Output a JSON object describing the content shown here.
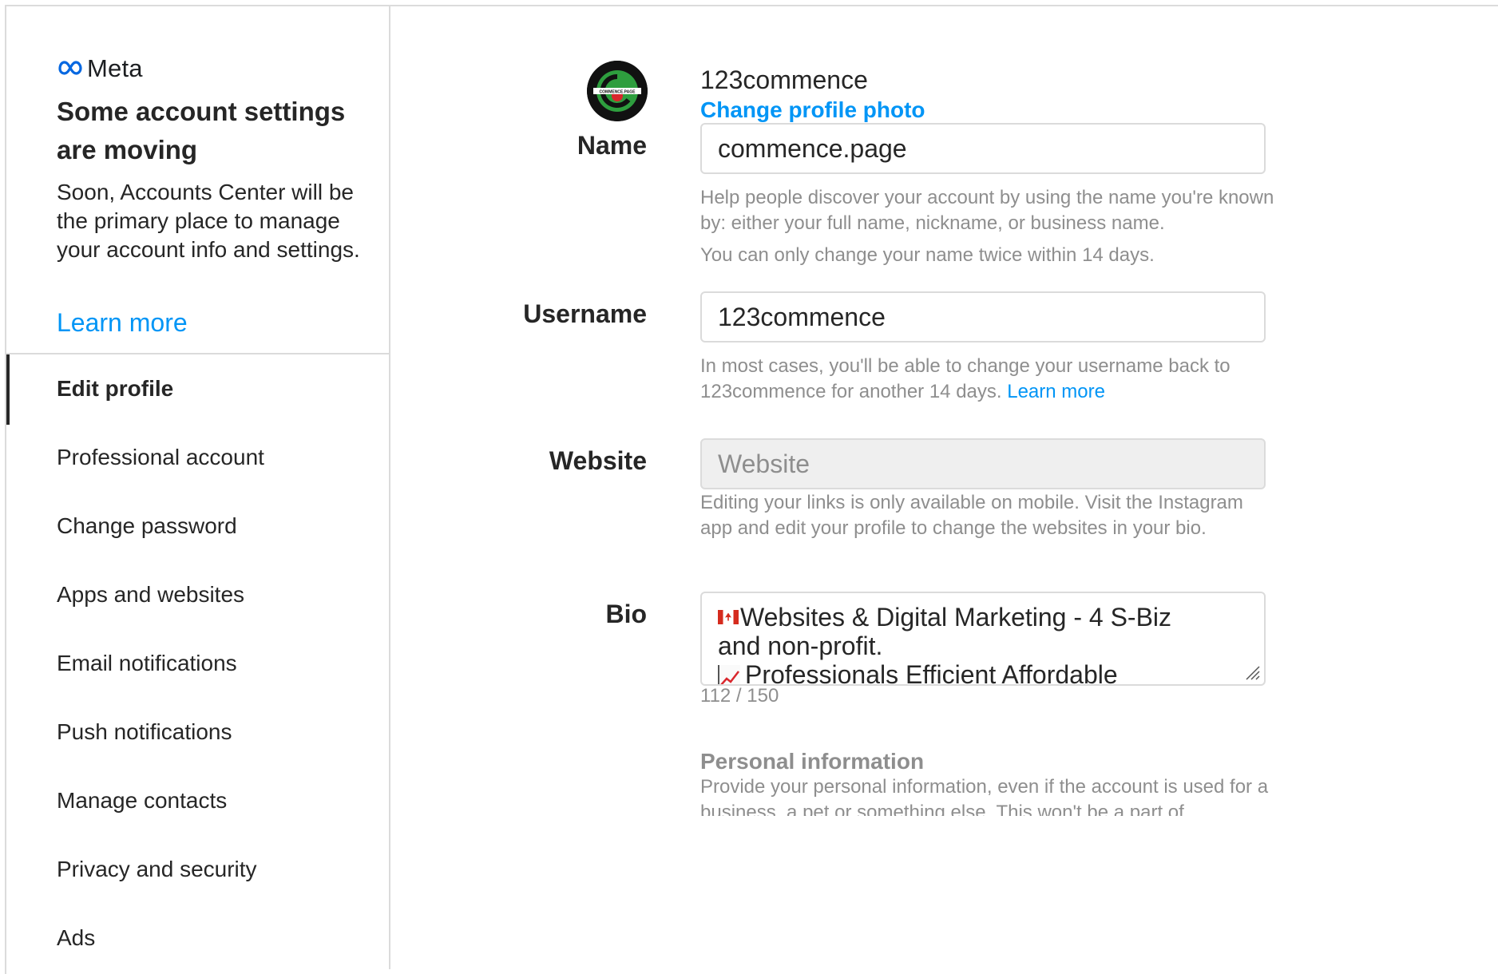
{
  "brand": {
    "name": "Meta",
    "color": "#0668E1"
  },
  "notice": {
    "title": "Some account settings are moving",
    "body": "Soon, Accounts Center will be the primary place to manage your account info and settings.",
    "learn_more": "Learn more"
  },
  "nav": {
    "items": [
      {
        "label": "Edit profile",
        "active": true
      },
      {
        "label": "Professional account"
      },
      {
        "label": "Change password"
      },
      {
        "label": "Apps and websites"
      },
      {
        "label": "Email notifications"
      },
      {
        "label": "Push notifications"
      },
      {
        "label": "Manage contacts"
      },
      {
        "label": "Privacy and security"
      },
      {
        "label": "Ads"
      }
    ]
  },
  "profile": {
    "username": "123commence",
    "change_photo": "Change profile photo",
    "avatar_text": "COMMENCE.PAGE"
  },
  "form": {
    "name": {
      "label": "Name",
      "value": "commence.page",
      "help1": "Help people discover your account by using the name you're known by: either your full name, nickname, or business name.",
      "help2": "You can only change your name twice within 14 days."
    },
    "username": {
      "label": "Username",
      "value": "123commence",
      "help": "In most cases, you'll be able to change your username back to 123commence for another 14 days.",
      "help_link": "Learn more"
    },
    "website": {
      "label": "Website",
      "placeholder": "Website",
      "help": "Editing your links is only available on mobile. Visit the Instagram app and edit your profile to change the websites in your bio."
    },
    "bio": {
      "label": "Bio",
      "line1": "Websites & Digital Marketing - 4 S-Biz",
      "line2": "and non-profit.",
      "line3": "Professionals Efficient Affordable",
      "counter": "112 / 150"
    },
    "personal": {
      "title": "Personal information",
      "body": "Provide your personal information, even if the account is used for a business, a pet or something else. This won't be a part of"
    }
  },
  "colors": {
    "accent": "#0095f6",
    "muted": "#8e8e8e",
    "border": "#dbdbdb"
  }
}
